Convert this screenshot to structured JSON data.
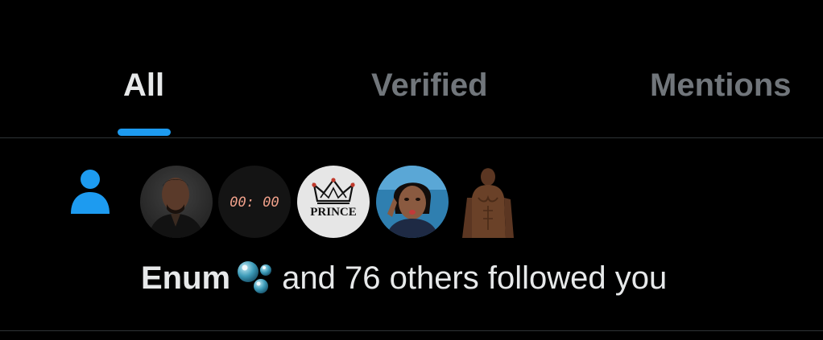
{
  "tabs": [
    {
      "label": "All",
      "active": true
    },
    {
      "label": "Verified",
      "active": false
    },
    {
      "label": "Mentions",
      "active": false
    }
  ],
  "colors": {
    "background": "#000000",
    "accent": "#1d9bf0",
    "text_primary": "#e7e9ea",
    "text_secondary": "#71767b",
    "divider": "#2f3336"
  },
  "notification": {
    "type_icon": "person-icon",
    "avatars": [
      {
        "icon": "avatar-man-photo"
      },
      {
        "icon": "avatar-digital-clock",
        "clock_text": "00: 00"
      },
      {
        "icon": "avatar-prince-crown-logo",
        "logo_text": "PRINCE"
      },
      {
        "icon": "avatar-woman-photo"
      },
      {
        "icon": "avatar-shirtless-man-photo"
      }
    ],
    "actor_name": "Enum",
    "actor_emoji": "bubbles-icon",
    "message": "and 76 others followed you"
  }
}
